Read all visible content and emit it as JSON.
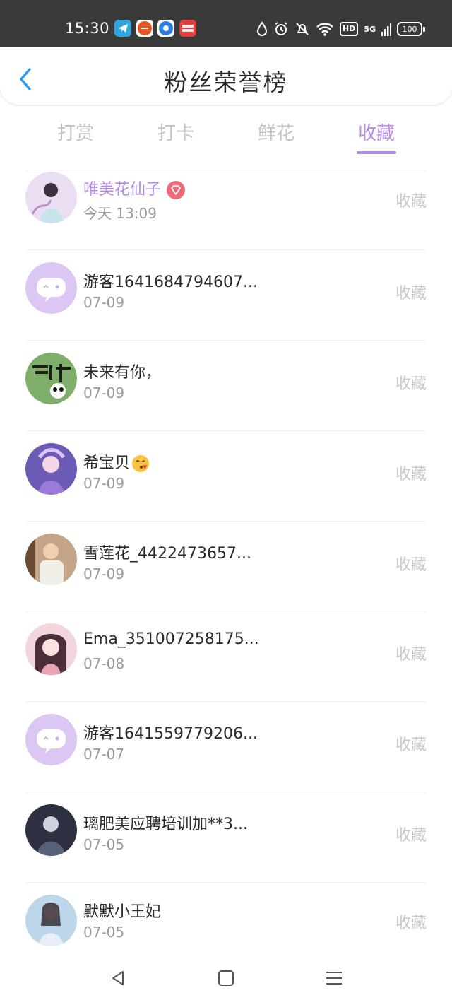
{
  "status_bar": {
    "time": "15:30",
    "battery": "100",
    "hd": "HD",
    "network": "5G"
  },
  "header": {
    "title": "粉丝荣誉榜"
  },
  "tabs": [
    {
      "label": "打赏"
    },
    {
      "label": "打卡"
    },
    {
      "label": "鲜花"
    },
    {
      "label": "收藏"
    }
  ],
  "rows": [
    {
      "name": "唯美花仙子",
      "time": "今天 13:09",
      "action": "收藏"
    },
    {
      "name": "游客1641684794607...",
      "time": "07-09",
      "action": "收藏"
    },
    {
      "name": "未来有你，",
      "time": "07-09",
      "action": "收藏"
    },
    {
      "name": "希宝贝",
      "time": "07-09",
      "action": "收藏"
    },
    {
      "name": "雪莲花_4422473657...",
      "time": "07-09",
      "action": "收藏"
    },
    {
      "name": "Ema_351007258175...",
      "time": "07-08",
      "action": "收藏"
    },
    {
      "name": "游客1641559779206...",
      "time": "07-07",
      "action": "收藏"
    },
    {
      "name": "璃肥美应聘培训加**3...",
      "time": "07-05",
      "action": "收藏"
    },
    {
      "name": "默默小王妃",
      "time": "07-05",
      "action": "收藏"
    }
  ],
  "colors": {
    "accent": "#b58ae6",
    "badge": "#ee6a78"
  }
}
